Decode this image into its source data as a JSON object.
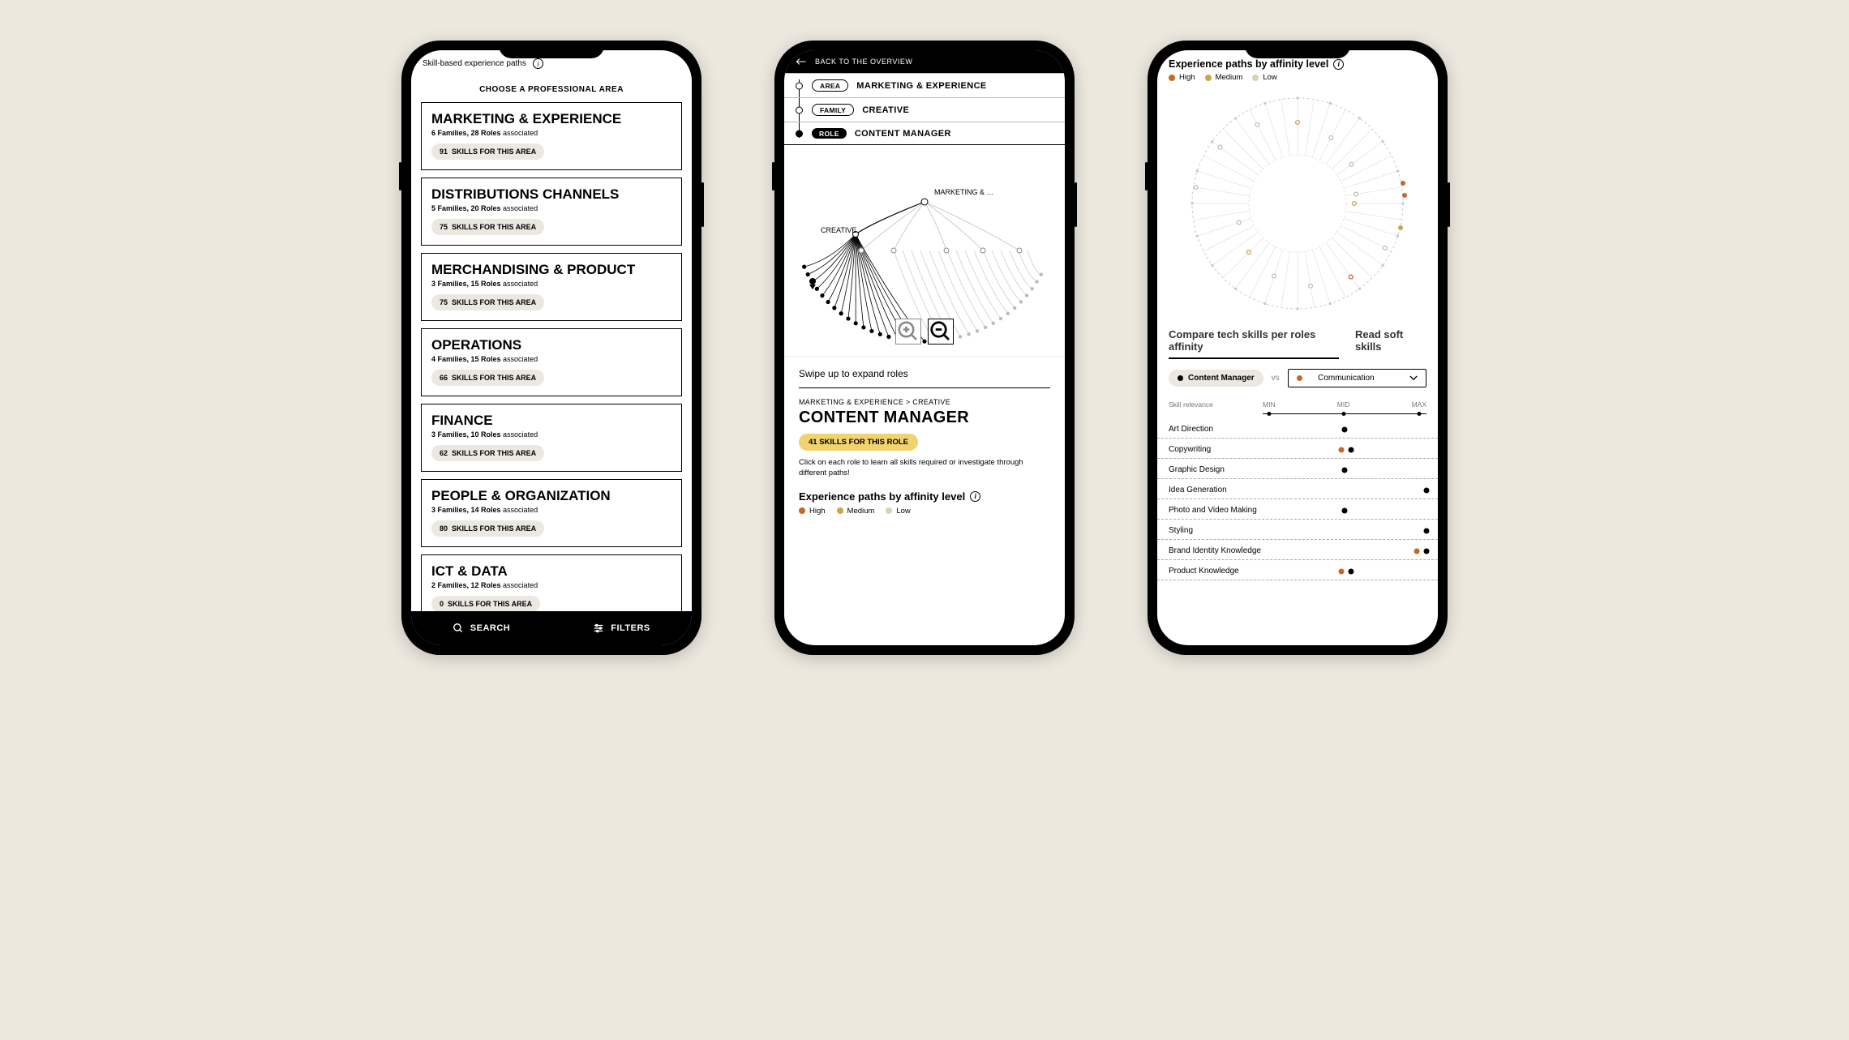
{
  "phone1": {
    "header": "Skill-based experience paths",
    "choose": "CHOOSE A PROFESSIONAL AREA",
    "areas": [
      {
        "title": "MARKETING & EXPERIENCE",
        "families": 6,
        "roles": 28,
        "skills": 91
      },
      {
        "title": "DISTRIBUTIONS CHANNELS",
        "families": 5,
        "roles": 20,
        "skills": 75
      },
      {
        "title": "MERCHANDISING & PRODUCT",
        "families": 3,
        "roles": 15,
        "skills": 75
      },
      {
        "title": "OPERATIONS",
        "families": 4,
        "roles": 15,
        "skills": 66
      },
      {
        "title": "FINANCE",
        "families": 3,
        "roles": 10,
        "skills": 62
      },
      {
        "title": "PEOPLE & ORGANIZATION",
        "families": 3,
        "roles": 14,
        "skills": 80
      },
      {
        "title": "ICT & DATA",
        "families": 2,
        "roles": 12,
        "skills": 0
      }
    ],
    "meta_assoc": "associated",
    "skills_suffix": "SKILLS FOR THIS AREA",
    "families_label": "Families,",
    "roles_label": "Roles",
    "search": "SEARCH",
    "filters": "FILTERS"
  },
  "phone2": {
    "back": "BACK TO THE OVERVIEW",
    "crumbs": {
      "area_label": "AREA",
      "area_value": "MARKETING & EXPERIENCE",
      "family_label": "FAMILY",
      "family_value": "CREATIVE",
      "role_label": "ROLE",
      "role_value": "CONTENT MANAGER"
    },
    "viz": {
      "root": "MARKETING & …",
      "child": "CREATIVE"
    },
    "swipe": "Swipe up to expand roles",
    "sheet_crumb": "MARKETING & EXPERIENCE > CREATIVE",
    "sheet_title": "CONTENT MANAGER",
    "sheet_chip_n": "41",
    "sheet_chip_txt": "SKILLS FOR THIS ROLE",
    "sheet_desc": "Click on each role to learn all skills required or investigate through different paths!",
    "affinity": "Experience paths by affinity level",
    "legend": {
      "high": "High",
      "medium": "Medium",
      "low": "Low"
    }
  },
  "phone3": {
    "title": "Experience paths by affinity level",
    "legend": {
      "high": "High",
      "medium": "Medium",
      "low": "Low"
    },
    "tabs": {
      "a": "Compare tech skills per roles affinity",
      "b": "Read soft skills"
    },
    "role": "Content Manager",
    "vs": "vs",
    "compare_to": "Communication",
    "axis": {
      "label": "Skill relevance",
      "min": "MIN",
      "mid": "MID",
      "max": "MAX"
    },
    "skills": [
      {
        "name": "Art Direction",
        "black": 50
      },
      {
        "name": "Copywriting",
        "black": 54,
        "orange": 48
      },
      {
        "name": "Graphic Design",
        "black": 50
      },
      {
        "name": "Idea Generation",
        "black": 100
      },
      {
        "name": "Photo and Video Making",
        "black": 50
      },
      {
        "name": "Styling",
        "black": 100
      },
      {
        "name": "Brand Identity Knowledge",
        "black": 100,
        "orange": 94
      },
      {
        "name": "Product Knowledge",
        "black": 54,
        "orange": 48
      }
    ]
  }
}
